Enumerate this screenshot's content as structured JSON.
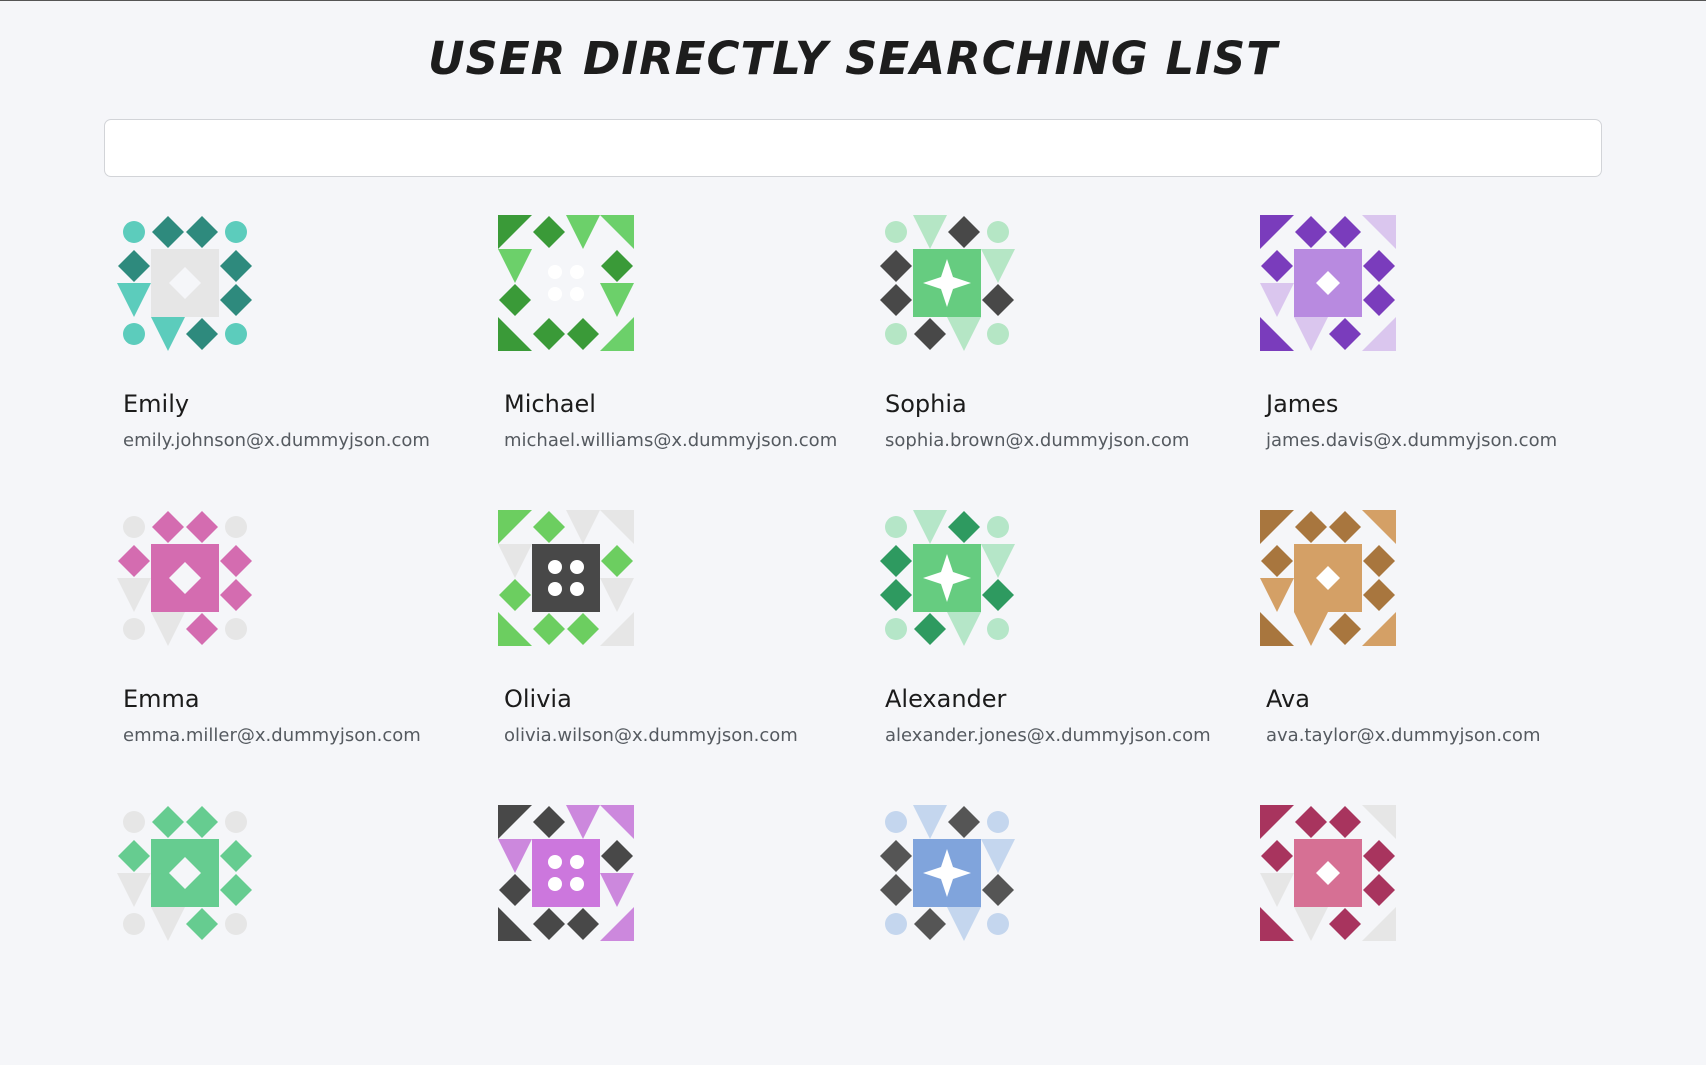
{
  "page": {
    "title": "USER DIRECTLY SEARCHING LIST"
  },
  "search": {
    "value": "",
    "placeholder": ""
  },
  "users": [
    {
      "name": "Emily",
      "email": "emily.johnson@x.dummyjson.com",
      "avatar_icon": "identicon-teal-diamonds",
      "colors": {
        "dark": "#2e8a7d",
        "light": "#5cccbc",
        "center": "#e6e6e6"
      }
    },
    {
      "name": "Michael",
      "email": "michael.williams@x.dummyjson.com",
      "avatar_icon": "identicon-green-diamonds",
      "colors": {
        "dark": "#3a9a38",
        "light": "#6cd06a",
        "center": "#f5f6f9"
      }
    },
    {
      "name": "Sophia",
      "email": "sophia.brown@x.dummyjson.com",
      "avatar_icon": "identicon-dark-diamonds-green-center",
      "colors": {
        "dark": "#484848",
        "light": "#b5e6c5",
        "center": "#66cc80"
      }
    },
    {
      "name": "James",
      "email": "james.davis@x.dummyjson.com",
      "avatar_icon": "identicon-purple",
      "colors": {
        "dark": "#7a3cbc",
        "light": "#dac6ee",
        "center": "#b88ae0"
      }
    },
    {
      "name": "Emma",
      "email": "emma.miller@x.dummyjson.com",
      "avatar_icon": "identicon-pink-dots",
      "colors": {
        "dark": "#d46cb0",
        "light": "#e6e6e6",
        "center": "#d46cb0"
      }
    },
    {
      "name": "Olivia",
      "email": "olivia.wilson@x.dummyjson.com",
      "avatar_icon": "identicon-green-dark-center",
      "colors": {
        "dark": "#6cce60",
        "light": "#e6e6e6",
        "center": "#484848"
      }
    },
    {
      "name": "Alexander",
      "email": "alexander.jones@x.dummyjson.com",
      "avatar_icon": "identicon-green-window",
      "colors": {
        "dark": "#2e9a60",
        "light": "#b5e6c8",
        "center": "#66cc80"
      }
    },
    {
      "name": "Ava",
      "email": "ava.taylor@x.dummyjson.com",
      "avatar_icon": "identicon-tan-pinwheel",
      "colors": {
        "dark": "#a8763e",
        "light": "#d4a066",
        "center": "#d4a066"
      }
    },
    {
      "name": "",
      "email": "",
      "avatar_icon": "identicon-mint-diamond",
      "colors": {
        "dark": "#66cc90",
        "light": "#e6e6e6",
        "center": "#66cc90"
      }
    },
    {
      "name": "",
      "email": "",
      "avatar_icon": "identicon-violet-dots",
      "colors": {
        "dark": "#484848",
        "light": "#cc88dd",
        "center": "#cc77dd"
      }
    },
    {
      "name": "",
      "email": "",
      "avatar_icon": "identicon-blue-diamond",
      "colors": {
        "dark": "#555555",
        "light": "#c4d6ee",
        "center": "#80a4dc"
      }
    },
    {
      "name": "",
      "email": "",
      "avatar_icon": "identicon-crimson-diamond",
      "colors": {
        "dark": "#a8345e",
        "light": "#e6e6e6",
        "center": "#d67094"
      }
    }
  ]
}
